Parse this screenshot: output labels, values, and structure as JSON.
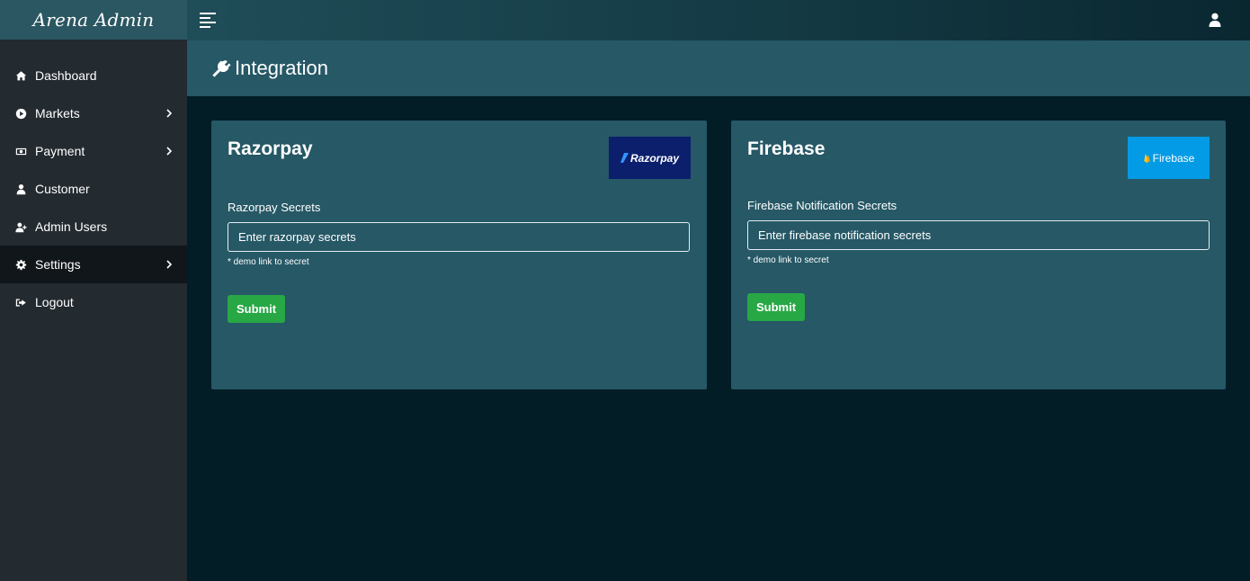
{
  "brand": "Arena Admin",
  "sidebar": {
    "items": [
      {
        "label": "Dashboard",
        "icon": "home-icon"
      },
      {
        "label": "Markets",
        "icon": "play-circle-icon"
      },
      {
        "label": "Payment",
        "icon": "money-icon"
      },
      {
        "label": "Customer",
        "icon": "user-icon"
      },
      {
        "label": "Admin Users",
        "icon": "user-plus-icon"
      },
      {
        "label": "Settings",
        "icon": "gear-icon"
      },
      {
        "label": "Logout",
        "icon": "sign-out-icon"
      }
    ],
    "active": "Settings"
  },
  "header": {
    "title": "Integration",
    "icon": "plug-icon"
  },
  "cards": {
    "razorpay": {
      "title": "Razorpay",
      "logo_text": "Razorpay",
      "field_label": "Razorpay Secrets",
      "placeholder": "Enter razorpay secrets",
      "hint": "* demo link to secret",
      "submit_label": "Submit"
    },
    "firebase": {
      "title": "Firebase",
      "logo_text": "Firebase",
      "field_label": "Firebase Notification Secrets",
      "placeholder": "Enter firebase notification secrets",
      "hint": "* demo link to secret",
      "submit_label": "Submit"
    }
  },
  "colors": {
    "sidebar_bg": "#232a30",
    "brand_bg": "#2a5762",
    "content_bg": "#021d26",
    "card_bg": "#265866",
    "submit_bg": "#28a745",
    "razorpay_logo_bg": "#0b1f6d",
    "firebase_logo_bg": "#039be5"
  }
}
